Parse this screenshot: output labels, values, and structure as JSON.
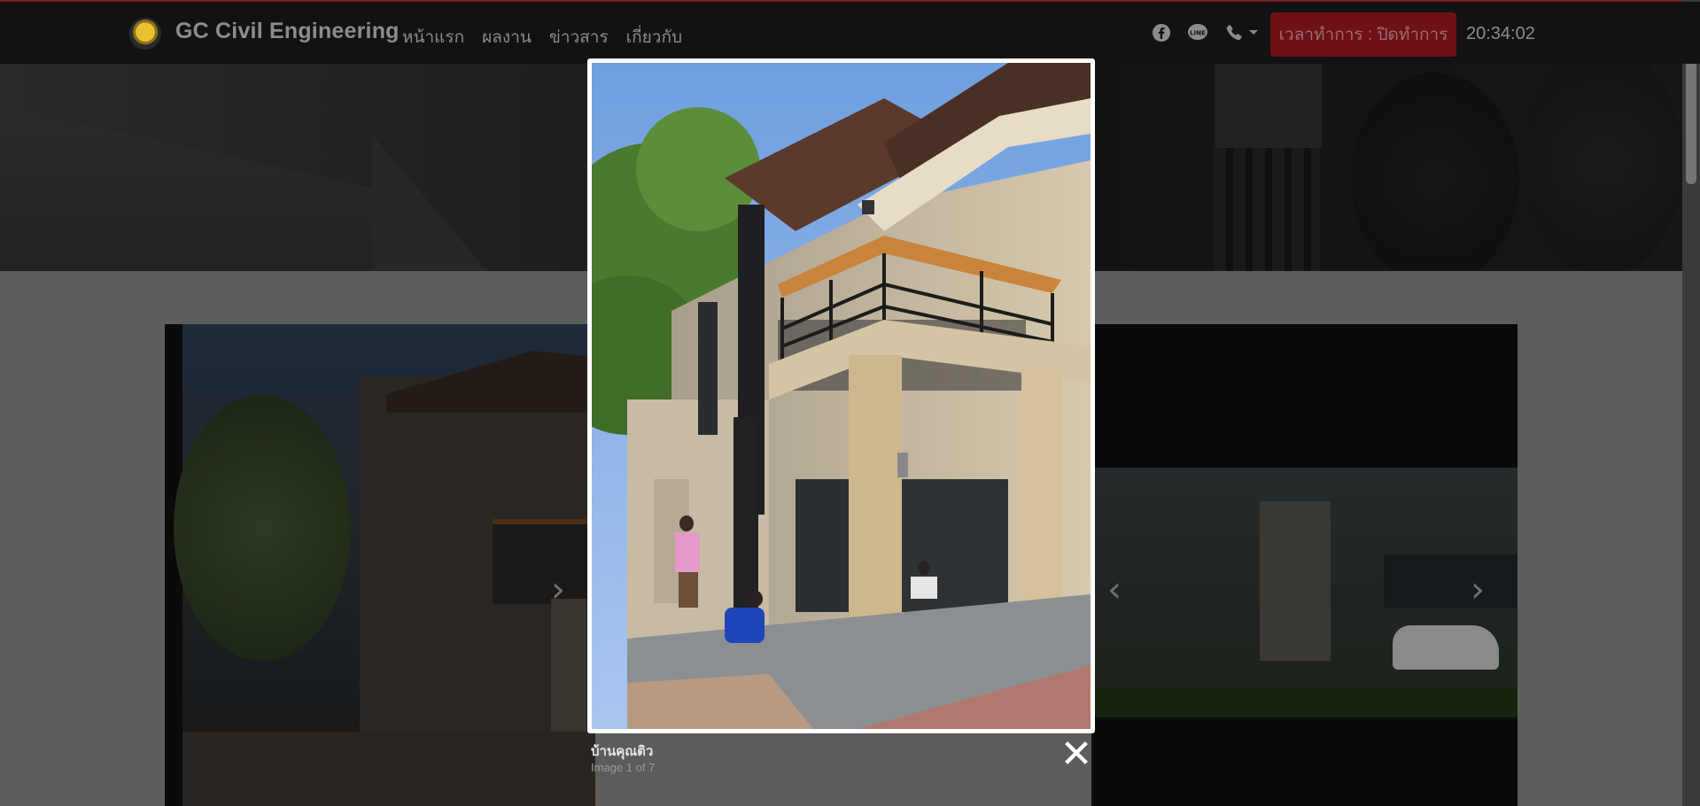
{
  "brand": {
    "name": "GC Civil Engineering"
  },
  "nav": {
    "items": [
      "หน้าแรก",
      "ผลงาน",
      "ข่าวสาร",
      "เกี่ยวกับ"
    ]
  },
  "status": {
    "office_hours": "เวลาทำการ : ปิดทำการ",
    "time": "20:34:02"
  },
  "icons": {
    "facebook": "facebook-icon",
    "line": "line-chat-icon",
    "phone": "phone-icon",
    "dropdown": "caret-down-icon",
    "prev": "chevron-left-icon",
    "next": "chevron-right-icon",
    "close": "close-icon"
  },
  "gallery": {
    "prev_glyph": "‹",
    "next_glyph": "›"
  },
  "lightbox": {
    "title": "บ้านคุณติว",
    "counter": "Image 1 of 7",
    "close_glyph": "✕"
  },
  "colors": {
    "navbar_bg": "#121212",
    "office_hours_bg": "#6e1016",
    "overlay": "#5c5c5c",
    "lightbox_border": "#ffffff"
  }
}
